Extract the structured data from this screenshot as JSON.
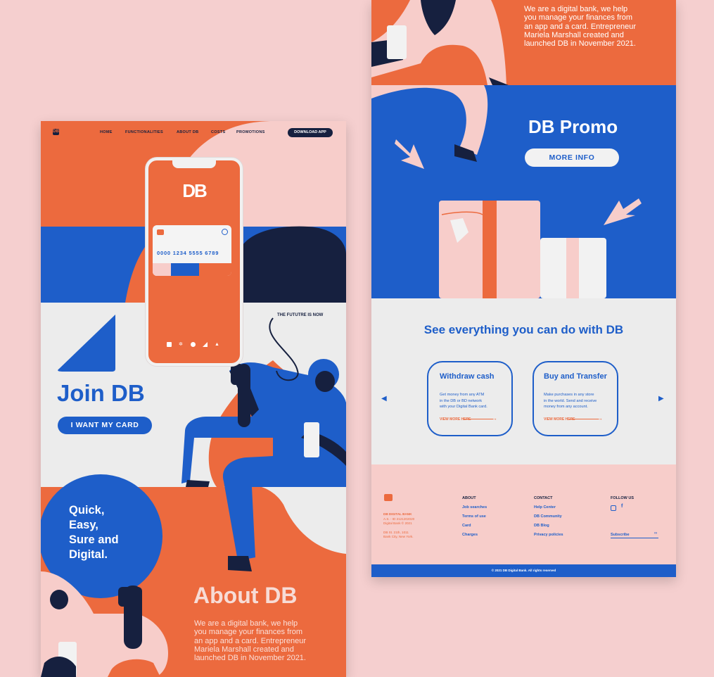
{
  "colors": {
    "background": "#f5cfcf",
    "orange": "#ec6a3e",
    "blue": "#1e5ec9",
    "navy": "#16203f",
    "pink": "#f7cdca",
    "light": "#ececec"
  },
  "left": {
    "nav": {
      "logo": "DB",
      "items": [
        "HOME",
        "FUNCTIONALITIES",
        "ABOUT DB",
        "COSTS",
        "PROMOTIONS"
      ],
      "download": "DOWNLOAD APP"
    },
    "phone": {
      "logo": "DB",
      "card_number": "0000 1234 5555 6789"
    },
    "tagline": "THE FUTUTRE IS NOW",
    "hero": {
      "title": "Join DB",
      "button": "I WANT MY CARD"
    },
    "circle": {
      "lines": [
        "Quick,",
        "Easy,",
        "Sure and",
        "Digital."
      ]
    },
    "about": {
      "title": "About DB",
      "lines": [
        "We are a digital bank, we help",
        "you manage your finances from",
        "an app and a card. Entrepreneur",
        "Mariela Marshall created and",
        "launched DB in November 2021."
      ]
    }
  },
  "right": {
    "top_lines": [
      "We are a digital bank, we help",
      "you manage your finances from",
      "an app and a card. Entrepreneur",
      "Mariela Marshall created and",
      "launched DB in November 2021."
    ],
    "promo": {
      "title": "DB Promo",
      "button": "MORE INFO"
    },
    "features": {
      "title": "See everything you can do with DB",
      "cards": [
        {
          "title": "Withdraw cash",
          "lines": [
            "Get money from any ATM",
            "in the DB or BD network",
            "with your Digital Bank card."
          ],
          "link": "VIEW MORE HERE"
        },
        {
          "title": "Buy and Transfer",
          "lines": [
            "Make purchases in any store",
            "in the world. Send and receive",
            "money from any account."
          ],
          "link": "VIEW MORE HERE"
        }
      ]
    },
    "footer": {
      "company": [
        "DB DIGITAL BANK",
        "A.S. - ID 2121202020",
        "Digital Bank © 2021"
      ],
      "address": [
        "DB St. 21th, 1011",
        "Bank City, New York."
      ],
      "about": {
        "heading": "ABOUT",
        "links": [
          "Job searches",
          "Terms of use",
          "Card",
          "Charges"
        ]
      },
      "contact": {
        "heading": "CONTACT",
        "links": [
          "Help Center",
          "DB Community",
          "DB Blog",
          "Privacy policies"
        ]
      },
      "follow": {
        "heading": "FOLLOW US",
        "subscribe": "Subscribe"
      },
      "copyright": "© 2021 DB Digital Bank. All rights reserved"
    }
  }
}
